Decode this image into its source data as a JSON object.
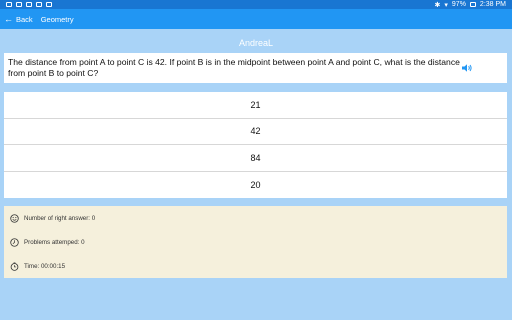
{
  "statusbar": {
    "battery": "97%",
    "time": "2:38 PM"
  },
  "actionbar": {
    "back_label": "Back",
    "title": "Geometry"
  },
  "player_name": "AndreaL",
  "question": {
    "text": "The distance from point A to point C is 42. If point B is in the midpoint between point A and point C, what is the distance from point B to point C?"
  },
  "answers": [
    "21",
    "42",
    "84",
    "20"
  ],
  "stats": {
    "right_answers": "Number of right answer: 0",
    "attempted": "Problems attemped: 0",
    "time": "Time: 00:00:15"
  },
  "icons": {
    "back": "arrow-left-icon",
    "speaker": "speaker-icon",
    "right": "smiley-icon",
    "attempted": "clock-icon",
    "time": "stopwatch-icon"
  },
  "colors": {
    "statusbar": "#1976d2",
    "actionbar": "#2196f3",
    "background": "#a9d3f7",
    "stats_bg": "#f5f0dc"
  }
}
